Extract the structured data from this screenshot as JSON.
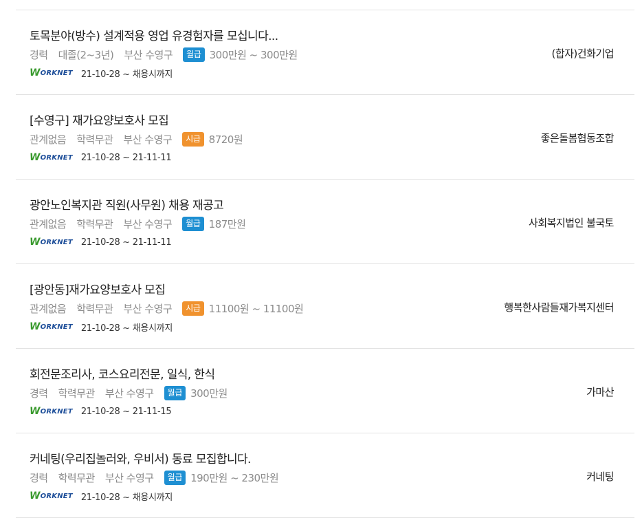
{
  "source_logo": {
    "w": "W",
    "rest": "ORKNET"
  },
  "jobs": [
    {
      "title": "토목분야(방수) 설계적용 영업 유경험자를 모십니다...",
      "experience": "경력",
      "education": "대졸(2~3년)",
      "location": "부산 수영구",
      "pay_type": "월급",
      "pay_kind": "monthly",
      "pay": "300만원 ~ 300만원",
      "period": "21-10-28 ~ 채용시까지",
      "company": "(합자)건화기업"
    },
    {
      "title": "[수영구] 재가요양보호사 모집",
      "experience": "관계없음",
      "education": "학력무관",
      "location": "부산 수영구",
      "pay_type": "시급",
      "pay_kind": "hourly",
      "pay": "8720원",
      "period": "21-10-28 ~ 21-11-11",
      "company": "좋은돌봄협동조합"
    },
    {
      "title": "광안노인복지관 직원(사무원) 채용 재공고",
      "experience": "관계없음",
      "education": "학력무관",
      "location": "부산 수영구",
      "pay_type": "월급",
      "pay_kind": "monthly",
      "pay": "187만원",
      "period": "21-10-28 ~ 21-11-11",
      "company": "사회복지법인 불국토"
    },
    {
      "title": "[광안동]재가요양보호사 모집",
      "experience": "관계없음",
      "education": "학력무관",
      "location": "부산 수영구",
      "pay_type": "시급",
      "pay_kind": "hourly",
      "pay": "11100원 ~ 11100원",
      "period": "21-10-28 ~ 채용시까지",
      "company": "행복한사람들재가복지센터"
    },
    {
      "title": "회전문조리사, 코스요리전문, 일식, 한식",
      "experience": "경력",
      "education": "학력무관",
      "location": "부산 수영구",
      "pay_type": "월급",
      "pay_kind": "monthly",
      "pay": "300만원",
      "period": "21-10-28 ~ 21-11-15",
      "company": "가마산"
    },
    {
      "title": "커네팅(우리집놀러와, 우비서) 동료 모집합니다.",
      "experience": "경력",
      "education": "학력무관",
      "location": "부산 수영구",
      "pay_type": "월급",
      "pay_kind": "monthly",
      "pay": "190만원 ~ 230만원",
      "period": "21-10-28 ~ 채용시까지",
      "company": "커네팅"
    }
  ]
}
